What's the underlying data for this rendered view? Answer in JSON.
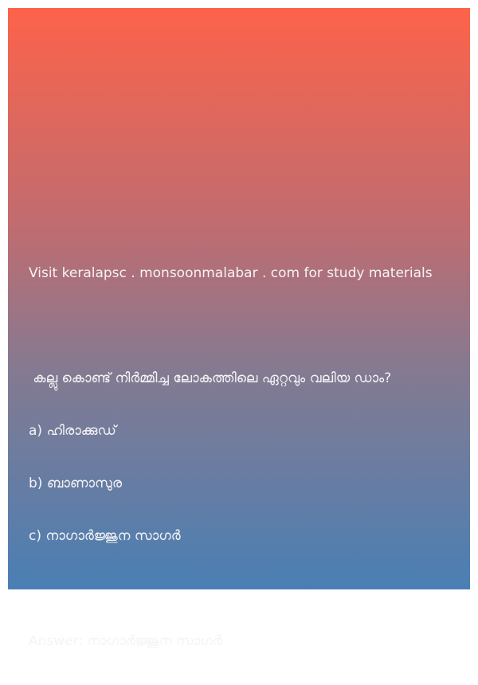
{
  "post": {
    "source_line": "Visit keralapsc . monsoonmalabar . com for study materials",
    "question": " കല്ലു കൊണ്ട് നിര്‍മ്മിച്ച ലോകത്തിലെ ഏറ്റവും വലിയ ഡാം?",
    "options": [
      "a) ഹിരാക്കുഡ്",
      "b) ബാണാസുര",
      "c) നാഗാര്‍ജ്ജുന സാഗര്‍"
    ],
    "answer_label": "Answer:",
    "answer_value": "നാഗാര്‍ജ്ജുന സാഗര്‍"
  },
  "colors": {
    "gradient_top": "#fd634a",
    "gradient_bottom": "#4a7fb4",
    "text": "#f4f4f4"
  }
}
